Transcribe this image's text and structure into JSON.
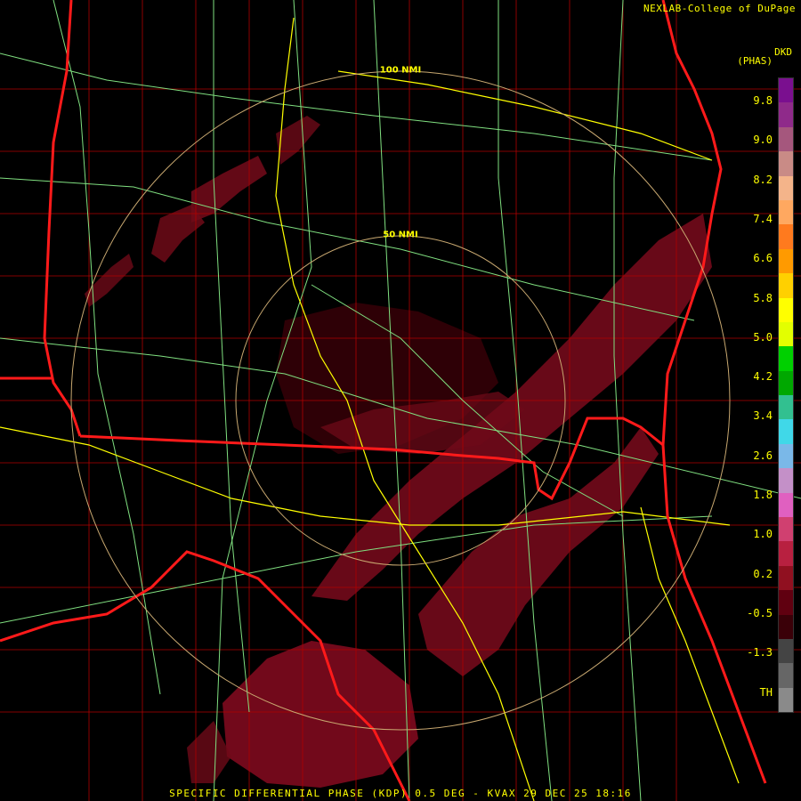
{
  "credit": "NEXLAB-College of DuPage",
  "product": {
    "code": "DKD",
    "units": "(PHAS)"
  },
  "footer": "SPECIFIC DIFFERENTIAL PHASE (KDP) 0.5 DEG - KVAX 29 DEC 25 18:16",
  "range_rings": [
    {
      "label": "50 NMI",
      "radius_nmi": 50
    },
    {
      "label": "100 NMI",
      "radius_nmi": 100
    }
  ],
  "colorbar": {
    "labels": [
      "9.8",
      "9.0",
      "8.2",
      "7.4",
      "6.6",
      "5.8",
      "5.0",
      "4.2",
      "3.4",
      "2.6",
      "1.8",
      "1.0",
      "0.2",
      "-0.5",
      "-1.3",
      "TH"
    ],
    "colors": [
      "#7a0f8f",
      "#8f2a8a",
      "#a5577d",
      "#c98b86",
      "#f4b48a",
      "#ffa860",
      "#ff7a1e",
      "#ff9a00",
      "#ffd000",
      "#ffff00",
      "#e3ff00",
      "#00d000",
      "#00a800",
      "#32c090",
      "#40d8e8",
      "#7ab8e8",
      "#c490c8",
      "#e060c0",
      "#d04070",
      "#b82040",
      "#901020",
      "#600010",
      "#3a0008",
      "#444444",
      "#666666",
      "#8a8a8a"
    ]
  },
  "colors": {
    "state_border": "#ff0000",
    "county_border": "#c00000",
    "highway": "#80e080",
    "interstate": "#ffff00",
    "range_ring": "#c8a870",
    "echo": "#8a0a1a"
  }
}
